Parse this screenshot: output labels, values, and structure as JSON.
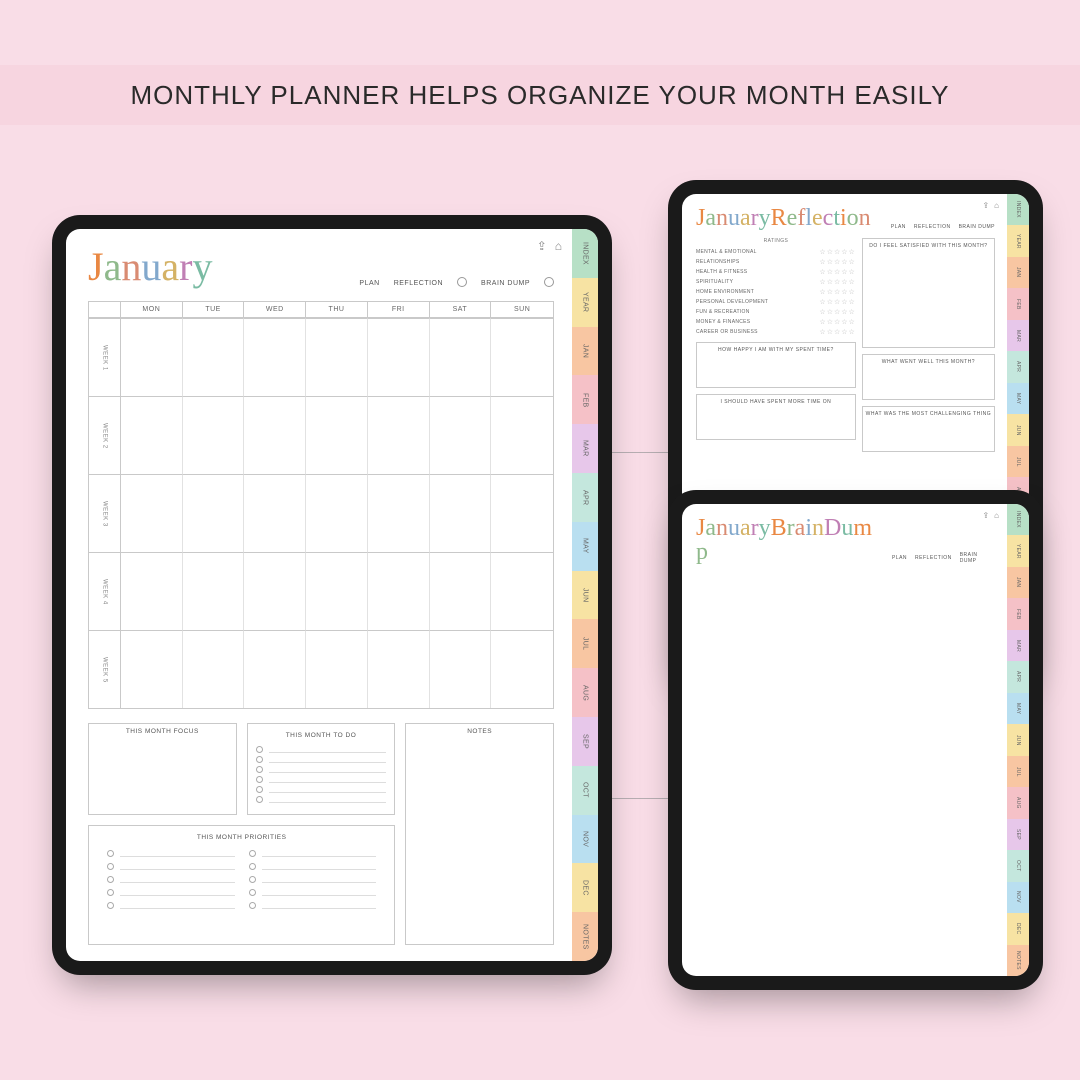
{
  "headline": "MONTHLY PLANNER HELPS ORGANIZE YOUR MONTH EASILY",
  "nav": {
    "plan": "PLAN",
    "reflection": "REFLECTION",
    "braindump": "BRAIN DUMP"
  },
  "icons": {
    "share": "⇪",
    "home": "⌂"
  },
  "sidetabs": [
    {
      "label": "INDEX",
      "color": "#b7e0c6"
    },
    {
      "label": "YEAR",
      "color": "#f7e3a3"
    },
    {
      "label": "JAN",
      "color": "#f8c6a2"
    },
    {
      "label": "FEB",
      "color": "#f5c1c7"
    },
    {
      "label": "MAR",
      "color": "#e7c7ea"
    },
    {
      "label": "APR",
      "color": "#c4e7dd"
    },
    {
      "label": "MAY",
      "color": "#b9dff0"
    },
    {
      "label": "JUN",
      "color": "#f7e3a3"
    },
    {
      "label": "JUL",
      "color": "#f8c6a2"
    },
    {
      "label": "AUG",
      "color": "#f5c1c7"
    },
    {
      "label": "SEP",
      "color": "#e7c7ea"
    },
    {
      "label": "OCT",
      "color": "#c4e7dd"
    },
    {
      "label": "NOV",
      "color": "#b9dff0"
    },
    {
      "label": "DEC",
      "color": "#f7e3a3"
    },
    {
      "label": "NOTES",
      "color": "#f8c6a2"
    }
  ],
  "main": {
    "title_letters": [
      {
        "t": "J",
        "c": "#e98843"
      },
      {
        "t": "a",
        "c": "#8fb98b"
      },
      {
        "t": "n",
        "c": "#d98b72"
      },
      {
        "t": "u",
        "c": "#82a8cc"
      },
      {
        "t": "a",
        "c": "#d4b265"
      },
      {
        "t": "r",
        "c": "#c07fb4"
      },
      {
        "t": "y",
        "c": "#7abba3"
      }
    ],
    "days": [
      "",
      "MON",
      "TUE",
      "WED",
      "THU",
      "FRI",
      "SAT",
      "SUN"
    ],
    "weeks": [
      "WEEK 1",
      "WEEK 2",
      "WEEK 3",
      "WEEK 4",
      "WEEK 5"
    ],
    "panels": {
      "focus": "THIS MONTH FOCUS",
      "todo": "THIS MONTH TO DO",
      "notes": "NOTES",
      "priorities": "THIS MONTH PRIORITIES"
    }
  },
  "reflect": {
    "title_letters": [
      {
        "t": "J",
        "c": "#e98843"
      },
      {
        "t": "a",
        "c": "#8fb98b"
      },
      {
        "t": "n",
        "c": "#d98b72"
      },
      {
        "t": "u",
        "c": "#82a8cc"
      },
      {
        "t": "a",
        "c": "#d4b265"
      },
      {
        "t": "r",
        "c": "#c07fb4"
      },
      {
        "t": "y",
        "c": "#7abba3"
      },
      {
        "t": " ",
        "c": "#000"
      },
      {
        "t": "R",
        "c": "#e98843"
      },
      {
        "t": "e",
        "c": "#8fb98b"
      },
      {
        "t": "f",
        "c": "#d98b72"
      },
      {
        "t": "l",
        "c": "#82a8cc"
      },
      {
        "t": "e",
        "c": "#d4b265"
      },
      {
        "t": "c",
        "c": "#c07fb4"
      },
      {
        "t": "t",
        "c": "#7abba3"
      },
      {
        "t": "i",
        "c": "#e98843"
      },
      {
        "t": "o",
        "c": "#8fb98b"
      },
      {
        "t": "n",
        "c": "#d98b72"
      }
    ],
    "ratings_header": "RATINGS",
    "right_header": "DO I FEEL SATISFIED WITH THIS MONTH?",
    "categories": [
      "MENTAL & EMOTIONAL",
      "RELATIONSHIPS",
      "HEALTH & FITNESS",
      "SPIRITUALITY",
      "HOME ENVIRONMENT",
      "PERSONAL DEVELOPMENT",
      "FUN & RECREATION",
      "MONEY & FINANCES",
      "CAREER OR BUSINESS"
    ],
    "boxes": {
      "happy": "HOW HAPPY I AM WITH MY SPENT TIME?",
      "wentwell": "WHAT WENT WELL THIS MONTH?",
      "moretime": "I SHOULD HAVE SPENT MORE TIME ON",
      "challenge": "WHAT WAS THE MOST CHALLENGING THING"
    }
  },
  "dump": {
    "title_letters": [
      {
        "t": "J",
        "c": "#e98843"
      },
      {
        "t": "a",
        "c": "#8fb98b"
      },
      {
        "t": "n",
        "c": "#d98b72"
      },
      {
        "t": "u",
        "c": "#82a8cc"
      },
      {
        "t": "a",
        "c": "#d4b265"
      },
      {
        "t": "r",
        "c": "#c07fb4"
      },
      {
        "t": "y",
        "c": "#7abba3"
      },
      {
        "t": " ",
        "c": "#000"
      },
      {
        "t": "B",
        "c": "#e98843"
      },
      {
        "t": "r",
        "c": "#8fb98b"
      },
      {
        "t": "a",
        "c": "#d98b72"
      },
      {
        "t": "i",
        "c": "#82a8cc"
      },
      {
        "t": "n",
        "c": "#d4b265"
      },
      {
        "t": " ",
        "c": "#000"
      },
      {
        "t": "D",
        "c": "#c07fb4"
      },
      {
        "t": "u",
        "c": "#7abba3"
      },
      {
        "t": "m",
        "c": "#e98843"
      },
      {
        "t": "p",
        "c": "#8fb98b"
      }
    ]
  }
}
